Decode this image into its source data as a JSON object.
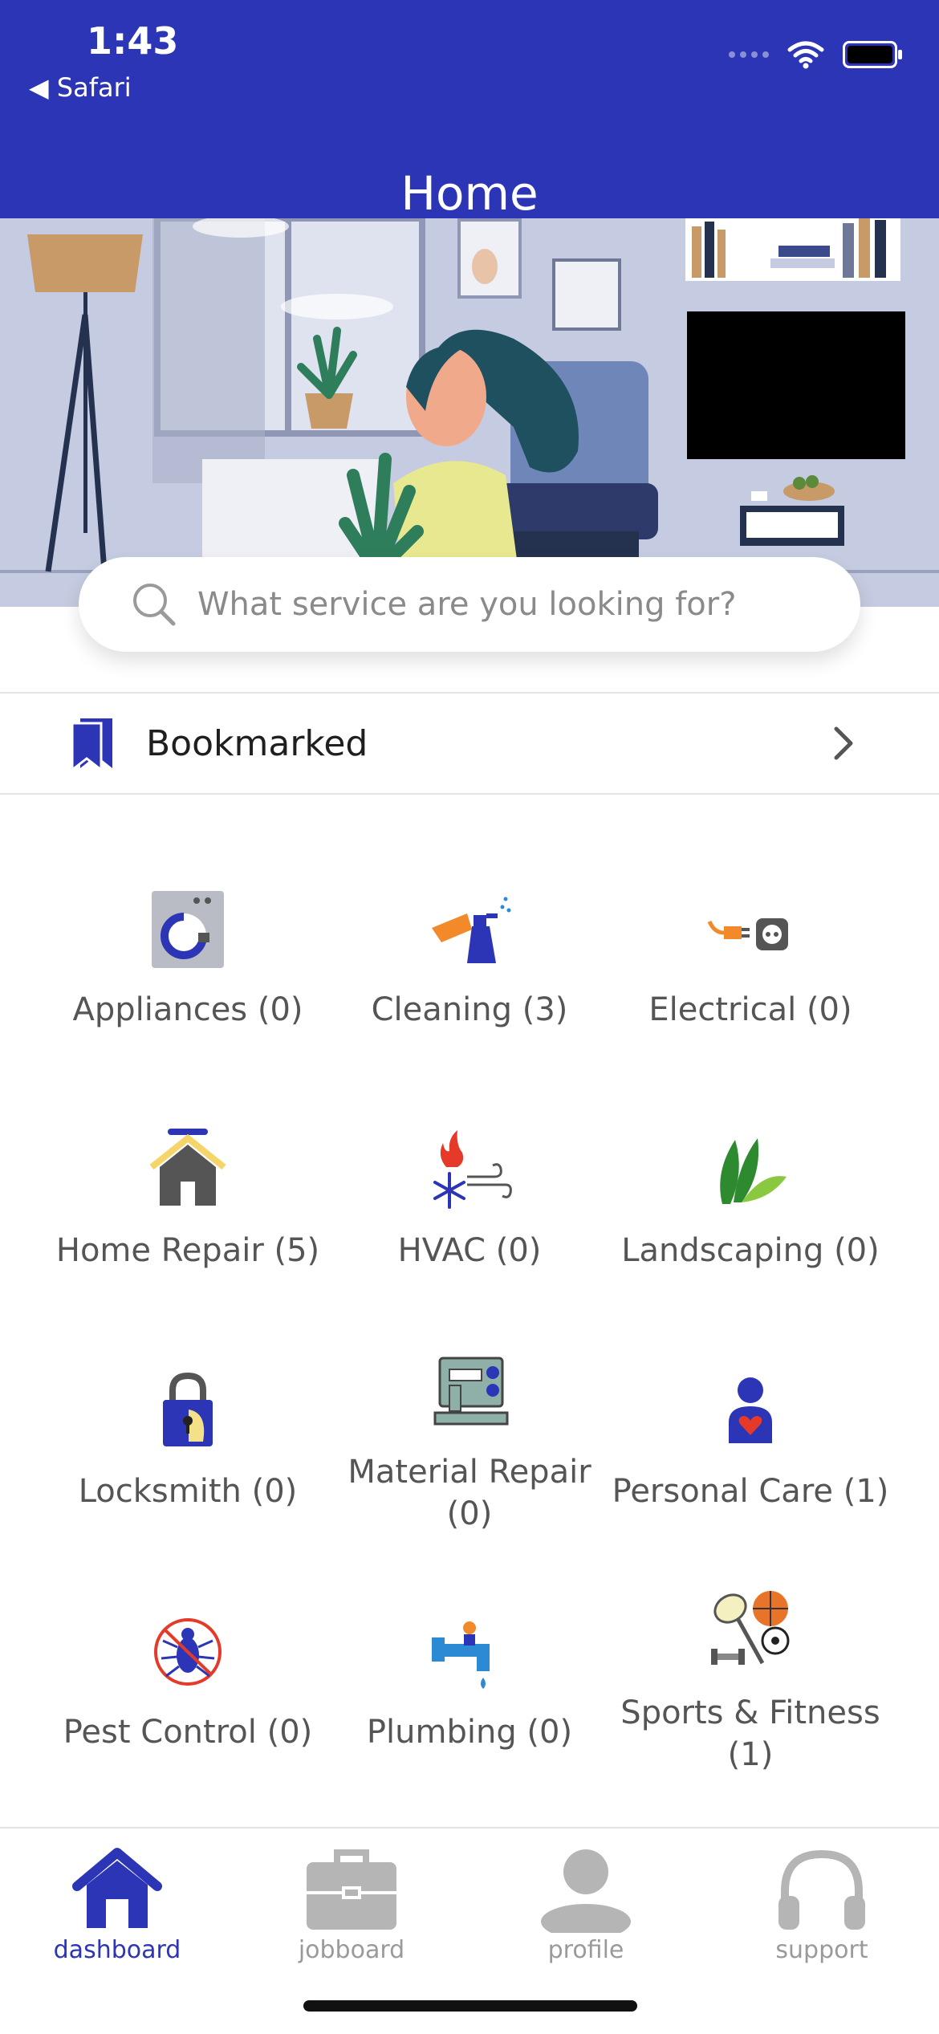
{
  "status_bar": {
    "time": "1:43",
    "back_label": "◀ Safari"
  },
  "header": {
    "title": "Home"
  },
  "search": {
    "placeholder": "What service are you looking for?"
  },
  "bookmarked": {
    "label": "Bookmarked"
  },
  "categories": [
    {
      "label": "Appliances (0)",
      "icon": "washing-machine-icon"
    },
    {
      "label": "Cleaning (3)",
      "icon": "spray-bottle-icon"
    },
    {
      "label": "Electrical (0)",
      "icon": "plug-outlet-icon"
    },
    {
      "label": "Home Repair (5)",
      "icon": "house-wrench-icon"
    },
    {
      "label": "HVAC (0)",
      "icon": "heat-cool-air-icon"
    },
    {
      "label": "Landscaping (0)",
      "icon": "leaves-icon"
    },
    {
      "label": "Locksmith (0)",
      "icon": "padlock-icon"
    },
    {
      "label": "Material Repair (0)",
      "icon": "sewing-machine-icon"
    },
    {
      "label": "Personal Care (1)",
      "icon": "person-heart-icon"
    },
    {
      "label": "Pest Control (0)",
      "icon": "no-bugs-icon"
    },
    {
      "label": "Plumbing (0)",
      "icon": "faucet-icon"
    },
    {
      "label": "Sports & Fitness (1)",
      "icon": "sports-balls-icon"
    }
  ],
  "tabs": [
    {
      "label": "dashboard",
      "icon": "house-icon",
      "active": true
    },
    {
      "label": "jobboard",
      "icon": "briefcase-icon",
      "active": false
    },
    {
      "label": "profile",
      "icon": "person-icon",
      "active": false
    },
    {
      "label": "support",
      "icon": "headphones-icon",
      "active": false
    }
  ],
  "colors": {
    "brand": "#2c35b5",
    "hero_bg": "#c5cbe0",
    "inactive_tab": "#b5b5b5"
  }
}
